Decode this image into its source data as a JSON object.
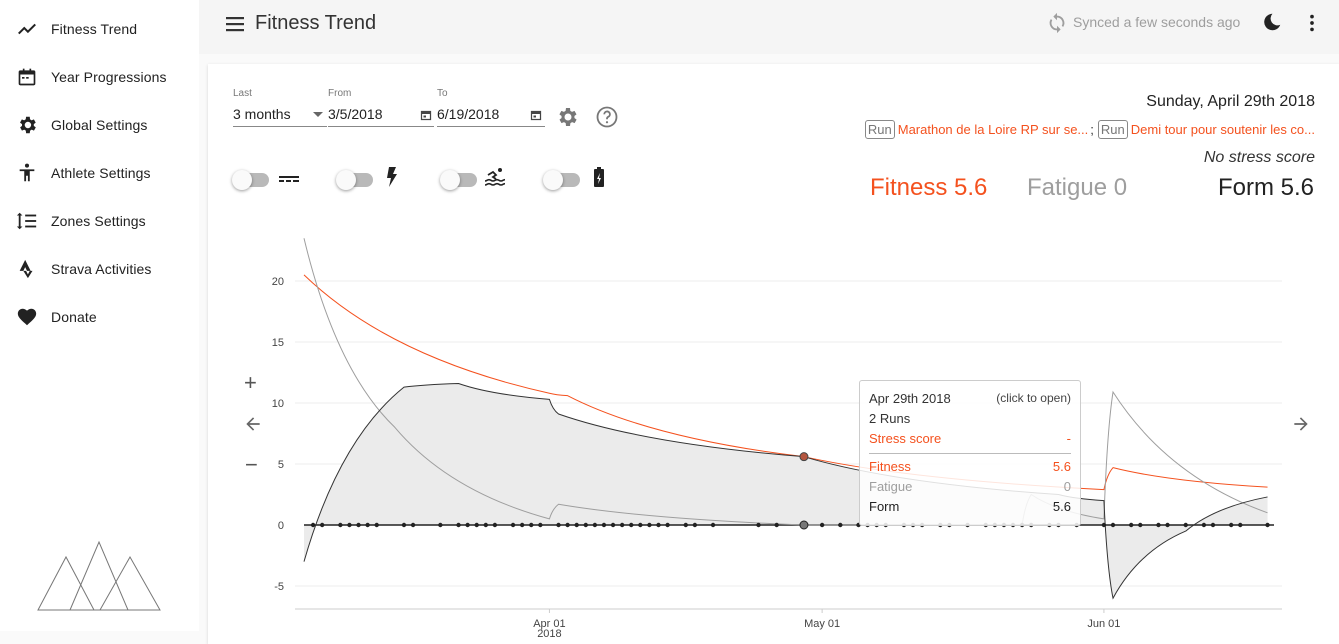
{
  "sidebar": {
    "items": [
      {
        "label": "Fitness Trend",
        "icon": "trend-icon"
      },
      {
        "label": "Year Progressions",
        "icon": "calendar-icon"
      },
      {
        "label": "Global Settings",
        "icon": "gear-icon"
      },
      {
        "label": "Athlete Settings",
        "icon": "athlete-icon"
      },
      {
        "label": "Zones Settings",
        "icon": "zones-icon"
      },
      {
        "label": "Strava Activities",
        "icon": "strava-icon"
      },
      {
        "label": "Donate",
        "icon": "heart-icon"
      }
    ]
  },
  "topbar": {
    "title": "Fitness Trend",
    "sync_status": "Synced a few seconds ago"
  },
  "filters": {
    "last_label": "Last",
    "last_value": "3 months",
    "from_label": "From",
    "from_value": "3/5/2018",
    "to_label": "To",
    "to_value": "6/19/2018"
  },
  "toggles": [
    {
      "icon": "dashed-lines-icon",
      "on": false
    },
    {
      "icon": "lightning-icon",
      "on": false
    },
    {
      "icon": "swimming-icon",
      "on": false
    },
    {
      "icon": "battery-icon",
      "on": false
    }
  ],
  "day": {
    "date": "Sunday, April 29th 2018",
    "activities": [
      {
        "type": "Run",
        "name": "Marathon de la Loire RP sur se...",
        "separator": ";"
      },
      {
        "type": "Run",
        "name": "Demi tour pour soutenir les co..."
      }
    ],
    "stress_note": "No stress score",
    "fitness": "Fitness 5.6",
    "fatigue": "Fatigue 0",
    "form": "Form 5.6"
  },
  "tooltip": {
    "date": "Apr 29th 2018",
    "hint": "(click to open)",
    "count": "2 Runs",
    "stress_label": "Stress score",
    "stress_value": "-",
    "fitness_label": "Fitness",
    "fitness_value": "5.6",
    "fatigue_label": "Fatigue",
    "fatigue_value": "0",
    "form_label": "Form",
    "form_value": "5.6"
  },
  "controls": {
    "zoom_in": "+",
    "zoom_out": "−"
  },
  "colors": {
    "fitness": "#f4511e",
    "fatigue": "#9e9e9e",
    "form": "#333333"
  },
  "chart_data": {
    "type": "line",
    "x_ticks": [
      "Apr 01",
      "May 01",
      "Jun 01"
    ],
    "x_year_label": "2018",
    "y_ticks": [
      20,
      15,
      10,
      5,
      0,
      -5
    ],
    "ylim": [
      -6.5,
      23.5
    ],
    "series": [
      {
        "name": "Fitness",
        "color": "#f4511e",
        "x": [
          "2018-03-05",
          "2018-04-01",
          "2018-04-03",
          "2018-04-29",
          "2018-06-01",
          "2018-06-02",
          "2018-06-19"
        ],
        "values": [
          20.5,
          10.8,
          10.6,
          5.6,
          2.9,
          4.7,
          3.1
        ]
      },
      {
        "name": "Fatigue",
        "color": "#9e9e9e",
        "x": [
          "2018-03-05",
          "2018-03-15",
          "2018-04-01",
          "2018-04-02",
          "2018-04-29",
          "2018-05-23",
          "2018-05-24",
          "2018-06-01",
          "2018-06-02",
          "2018-06-19"
        ],
        "values": [
          23.5,
          8.0,
          0.5,
          1.7,
          0,
          0,
          2.5,
          0.5,
          10.9,
          1.0
        ]
      },
      {
        "name": "Form",
        "color": "#333333",
        "x": [
          "2018-03-05",
          "2018-03-16",
          "2018-03-22",
          "2018-04-01",
          "2018-04-02",
          "2018-04-29",
          "2018-05-27",
          "2018-06-01",
          "2018-06-02",
          "2018-06-10",
          "2018-06-19"
        ],
        "values": [
          -3.0,
          11.3,
          11.6,
          10.3,
          9.1,
          5.6,
          2.5,
          2.0,
          -6.0,
          -0.5,
          2.3
        ]
      }
    ],
    "activity_dates": [
      "2018-03-06",
      "2018-03-07",
      "2018-03-09",
      "2018-03-10",
      "2018-03-11",
      "2018-03-12",
      "2018-03-13",
      "2018-03-16",
      "2018-03-17",
      "2018-03-20",
      "2018-03-22",
      "2018-03-23",
      "2018-03-24",
      "2018-03-25",
      "2018-03-26",
      "2018-03-28",
      "2018-03-29",
      "2018-03-30",
      "2018-03-31",
      "2018-04-02",
      "2018-04-03",
      "2018-04-04",
      "2018-04-05",
      "2018-04-06",
      "2018-04-07",
      "2018-04-08",
      "2018-04-09",
      "2018-04-10",
      "2018-04-11",
      "2018-04-12",
      "2018-04-13",
      "2018-04-14",
      "2018-04-16",
      "2018-04-17",
      "2018-04-19",
      "2018-04-24",
      "2018-04-26",
      "2018-04-29",
      "2018-05-01",
      "2018-05-03",
      "2018-05-05",
      "2018-05-06",
      "2018-05-07",
      "2018-05-08",
      "2018-05-10",
      "2018-05-11",
      "2018-05-12",
      "2018-05-14",
      "2018-05-15",
      "2018-05-17",
      "2018-05-19",
      "2018-05-20",
      "2018-05-21",
      "2018-05-22",
      "2018-05-23",
      "2018-05-24",
      "2018-05-26",
      "2018-05-27",
      "2018-05-29",
      "2018-06-01",
      "2018-06-02",
      "2018-06-04",
      "2018-06-05",
      "2018-06-07",
      "2018-06-08",
      "2018-06-10",
      "2018-06-12",
      "2018-06-13",
      "2018-06-15",
      "2018-06-16",
      "2018-06-19"
    ],
    "selected_date": "2018-04-29"
  }
}
